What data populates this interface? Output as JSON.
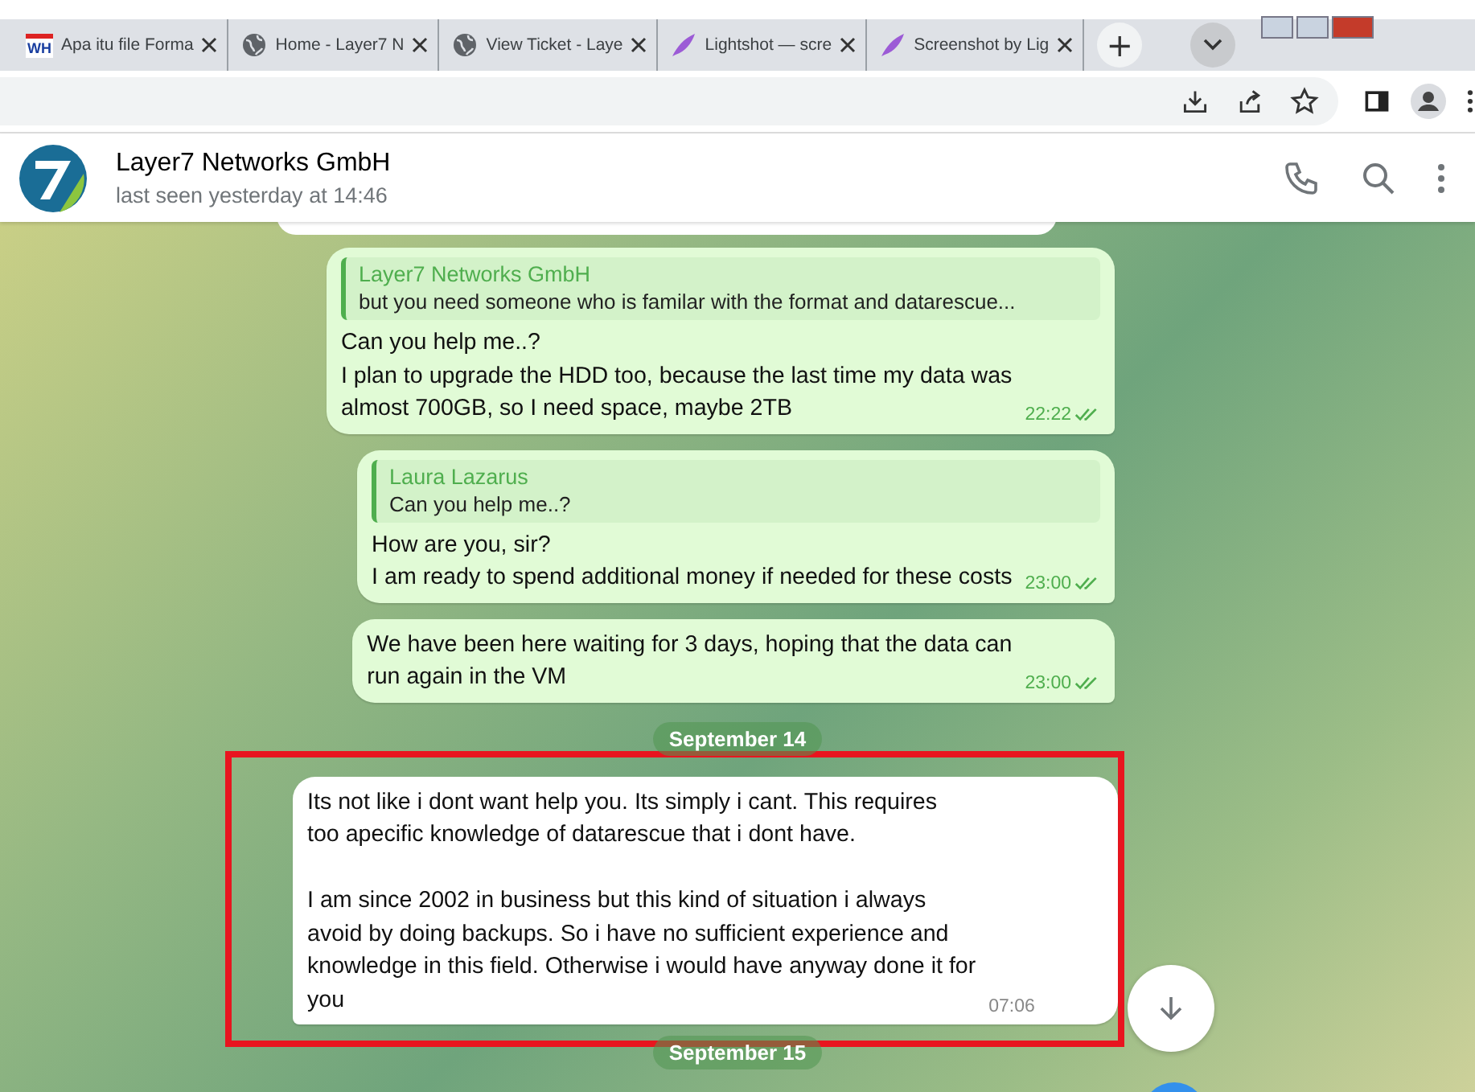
{
  "browser": {
    "tabs": [
      {
        "title": "Apa itu file Forma",
        "kind": "badge",
        "badge": "WH"
      },
      {
        "title": "Home - Layer7 N",
        "kind": "site"
      },
      {
        "title": "View Ticket - Laye",
        "kind": "site"
      },
      {
        "title": "Lightshot — scre",
        "kind": "app"
      },
      {
        "title": "Screenshot by Lig",
        "kind": "app"
      }
    ],
    "new_tab": "+"
  },
  "chat": {
    "title": "Layer7 Networks GmbH",
    "status": "last seen yesterday at 14:46"
  },
  "messages": [
    {
      "kind": "outgoing",
      "reply": {
        "author": "Layer7 Networks GmbH",
        "text": "but you need someone who is familar with the format and datarescue..."
      },
      "text": "Can you help me..?\nI plan to upgrade the HDD too, because the last time my data was\nalmost 700GB, so I need space, maybe 2TB",
      "time": "22:22",
      "read": true,
      "highlight": false
    },
    {
      "kind": "outgoing",
      "reply": {
        "author": "Laura Lazarus",
        "text": "Can you help me..?"
      },
      "text": "How are you, sir?\nI am ready to spend additional money if needed for these costs",
      "time": "23:00",
      "read": true,
      "highlight": false
    },
    {
      "kind": "outgoing",
      "text": "We have been here waiting for 3 days, hoping that the data can\nrun again in the VM",
      "time": "23:00",
      "read": true,
      "highlight": false
    },
    {
      "kind": "date",
      "text": "September 14"
    },
    {
      "kind": "incoming",
      "text": "Its not like i dont want help you. Its simply i cant. This requires\ntoo apecific knowledge of datarescue that i dont have.\n\nI am since 2002 in business but this kind of situation i always\navoid by doing backups. So i have no sufficient experience and\nknowledge in this field. Otherwise i would have anyway done it for\nyou",
      "time": "07:06",
      "read": false,
      "highlight": true
    },
    {
      "kind": "date",
      "text": "September 15"
    }
  ]
}
